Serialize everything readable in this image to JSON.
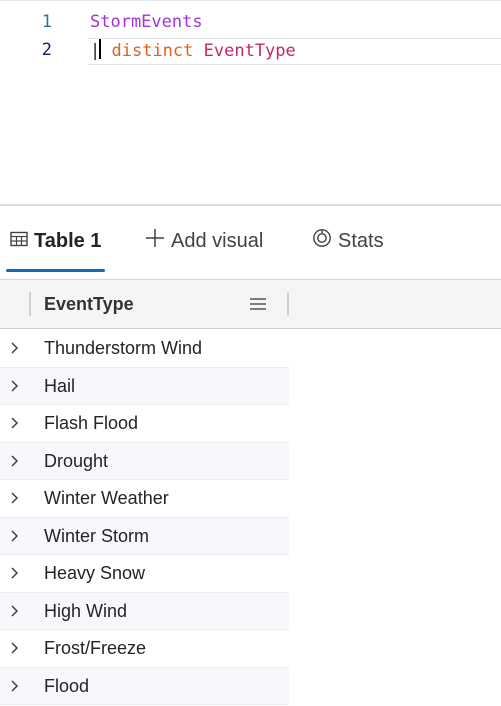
{
  "editor": {
    "lines": [
      {
        "number": "1",
        "table": "StormEvents"
      },
      {
        "number": "2",
        "pipe": "|",
        "keyword": "distinct",
        "column": "EventType"
      }
    ]
  },
  "tabs": [
    {
      "label": "Table 1",
      "icon": "table-icon",
      "active": true
    },
    {
      "label": "Add visual",
      "icon": "plus-icon"
    },
    {
      "label": "Stats",
      "icon": "stats-icon"
    }
  ],
  "grid": {
    "column_header": "EventType",
    "header_menu_icon": "hamburger-menu-icon",
    "row_expand_icon": "chevron-right-icon",
    "rows": [
      "Thunderstorm Wind",
      "Hail",
      "Flash Flood",
      "Drought",
      "Winter Weather",
      "Winter Storm",
      "Heavy Snow",
      "High Wind",
      "Frost/Freeze",
      "Flood"
    ]
  },
  "colors": {
    "accent": "#0f6cbd",
    "table_token": "#a034d6",
    "keyword_token": "#e5601b",
    "column_token": "#c7256b",
    "line_number": "#237893"
  }
}
